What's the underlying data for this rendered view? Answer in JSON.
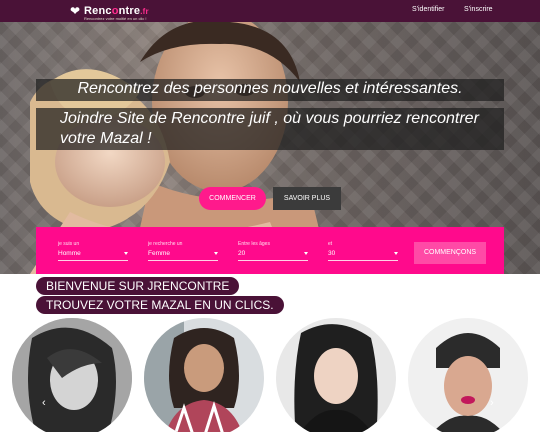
{
  "brand": {
    "name_a": "Renc",
    "name_o": "o",
    "name_b": "ntre",
    "name_tld": ".fr",
    "tagline": "Rencontrez votre moitié en un clic !"
  },
  "nav": {
    "login": "S'identifier",
    "signup": "S'inscrire"
  },
  "hero": {
    "headline_1": "Rencontrez des personnes nouvelles et intéressantes.",
    "headline_2": "Joindre Site de Rencontre juif , où vous pourriez rencontrer votre Mazal !",
    "start_button": "COMMENCER",
    "more_button": "SAVOIR PLUS"
  },
  "search": {
    "fields": [
      {
        "label": "je suis un",
        "value": "Homme"
      },
      {
        "label": "je recherche un",
        "value": "Femme"
      },
      {
        "label": "Entre les âges",
        "value": "20"
      },
      {
        "label": "et",
        "value": "30"
      }
    ],
    "submit": "COMMENÇONS"
  },
  "welcome": {
    "line_1": "BIENVENUE SUR JRENCONTRE",
    "line_2": "TROUVEZ VOTRE MAZAL EN UN CLICS."
  },
  "carousel": {
    "prev": "‹",
    "next": "›"
  },
  "colors": {
    "brand": "#4a1237",
    "accent": "#ff0a8c"
  }
}
